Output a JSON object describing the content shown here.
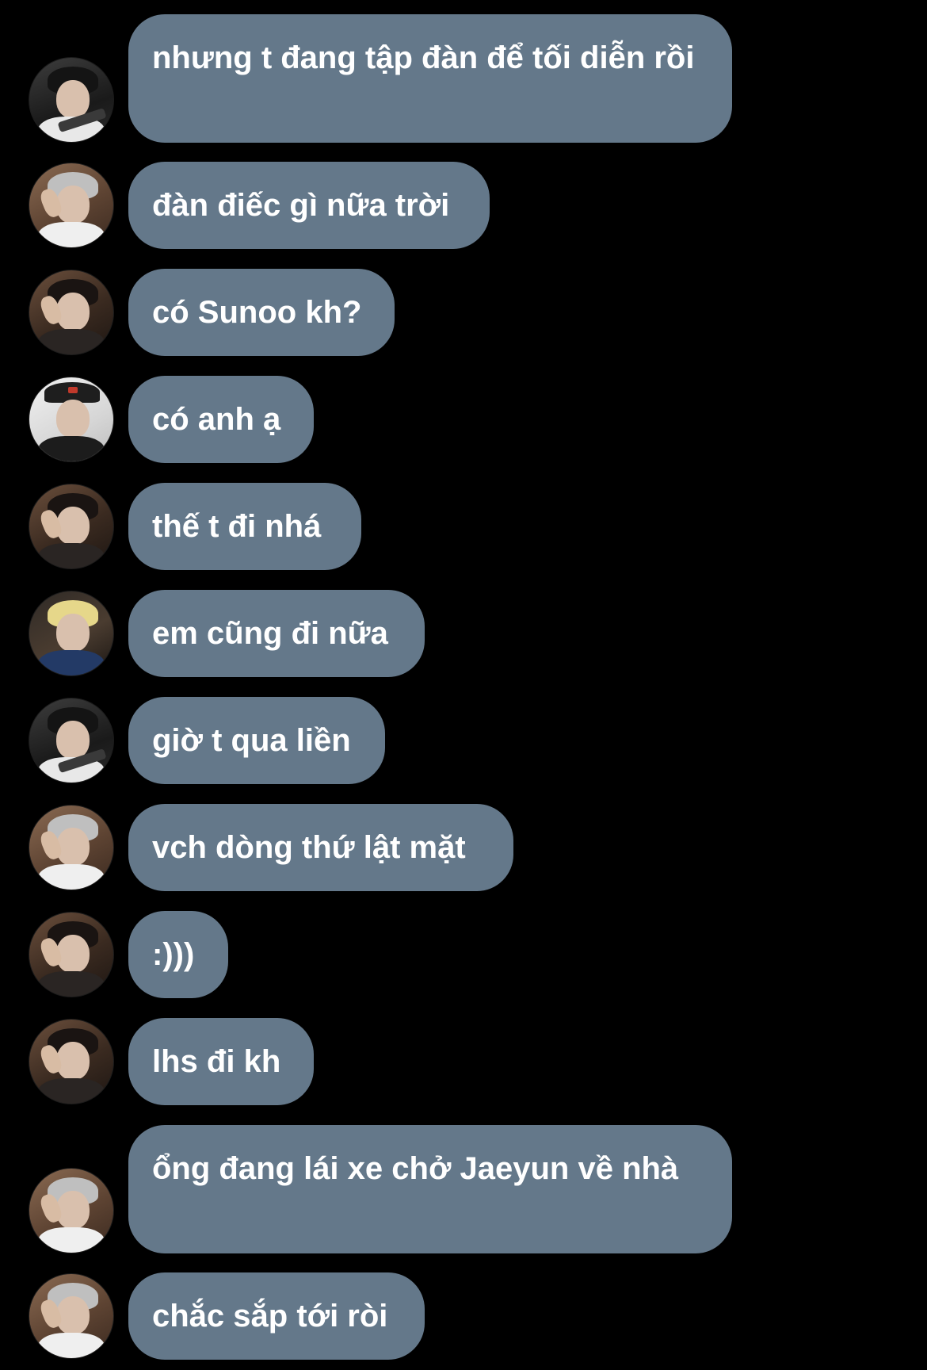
{
  "chat": {
    "bubble_color": "#64788a",
    "background_color": "#000000",
    "messages": [
      {
        "avatar": "avatar-a",
        "text": "nhưng t đang tập đàn để tối diễn rồi"
      },
      {
        "avatar": "avatar-b",
        "text": "đàn điếc gì nữa trời"
      },
      {
        "avatar": "avatar-c",
        "text": "có Sunoo kh?"
      },
      {
        "avatar": "avatar-d",
        "text": "có anh ạ"
      },
      {
        "avatar": "avatar-c",
        "text": "thế t đi nhá"
      },
      {
        "avatar": "avatar-e",
        "text": "em cũng đi nữa"
      },
      {
        "avatar": "avatar-a",
        "text": "giờ t qua liền"
      },
      {
        "avatar": "avatar-b",
        "text": "vch dòng thứ lật mặt"
      },
      {
        "avatar": "avatar-c",
        "text": ":)))"
      },
      {
        "avatar": "avatar-c",
        "text": "lhs đi kh"
      },
      {
        "avatar": "avatar-b",
        "text": "ổng đang lái xe chở Jaeyun về nhà"
      },
      {
        "avatar": "avatar-b",
        "text": "chắc sắp tới ròi"
      }
    ]
  }
}
